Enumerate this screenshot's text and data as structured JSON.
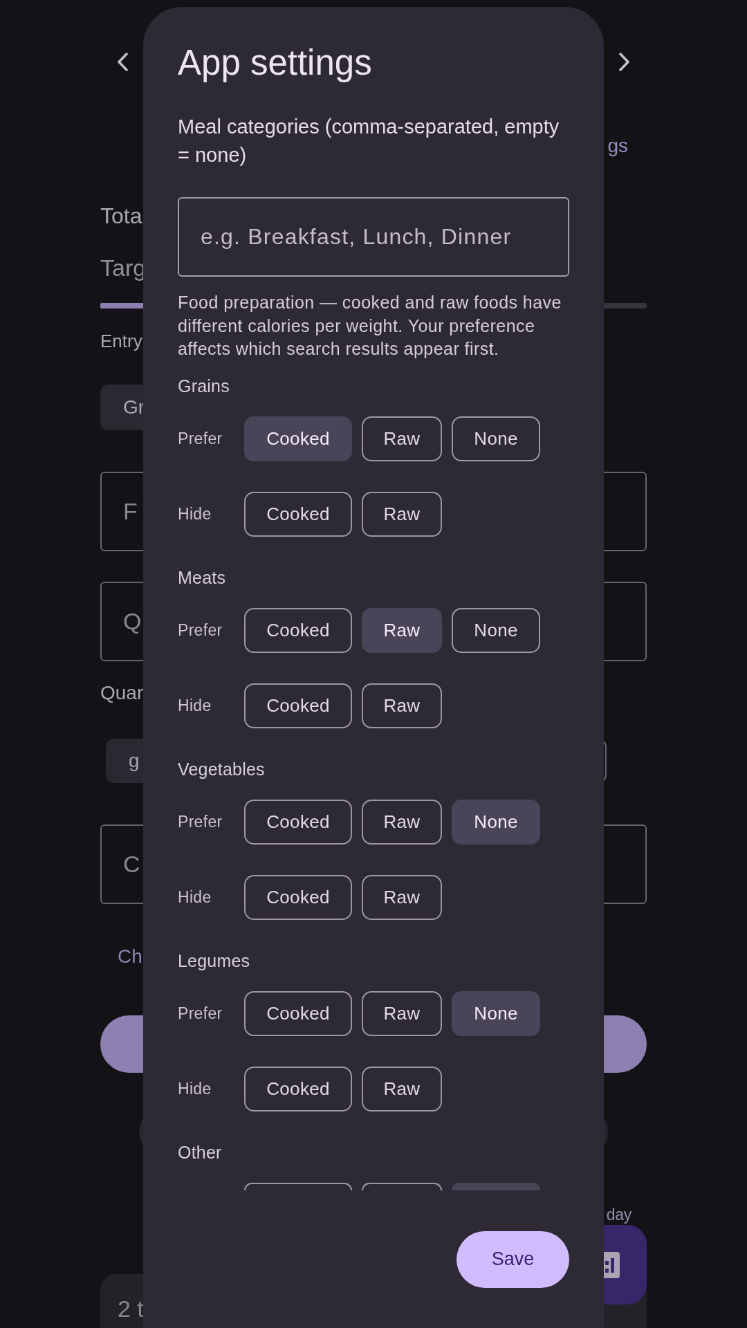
{
  "background": {
    "settings_link": "gs",
    "total_label": "Tota",
    "target_label": "Targ",
    "target_progress": {
      "level": 0.45
    },
    "entry_label": "Entry",
    "group_chip": "Gr",
    "food_field": {
      "placeholder": "F"
    },
    "quantity_field": {
      "placeholder": "Q"
    },
    "quantity_label": "Quar",
    "unit_chips": [
      {
        "label": "g",
        "selected": true
      },
      {
        "selected": false
      }
    ],
    "calories_field": {
      "placeholder": "C"
    },
    "link": "Ch",
    "today_label": "day",
    "entry_card": "2 t"
  },
  "dialog": {
    "title": "App settings",
    "categories_label": "Meal categories (comma-separated, empty = none)",
    "categories_field": {
      "placeholder": "e.g. Breakfast, Lunch, Dinner"
    },
    "note": "Food preparation — cooked and raw foods have different calories per weight. Your preference affects which search results appear first.",
    "sections": [
      {
        "name": "Grains",
        "rows": [
          {
            "label": "Prefer",
            "options": [
              {
                "label": "Cooked",
                "selected": true
              },
              {
                "label": "Raw",
                "selected": false
              },
              {
                "label": "None",
                "selected": false
              }
            ]
          },
          {
            "label": "Hide",
            "options": [
              {
                "label": "Cooked",
                "selected": false
              },
              {
                "label": "Raw",
                "selected": false
              }
            ]
          }
        ]
      },
      {
        "name": "Meats",
        "rows": [
          {
            "label": "Prefer",
            "options": [
              {
                "label": "Cooked",
                "selected": false
              },
              {
                "label": "Raw",
                "selected": true
              },
              {
                "label": "None",
                "selected": false
              }
            ]
          },
          {
            "label": "Hide",
            "options": [
              {
                "label": "Cooked",
                "selected": false
              },
              {
                "label": "Raw",
                "selected": false
              }
            ]
          }
        ]
      },
      {
        "name": "Vegetables",
        "rows": [
          {
            "label": "Prefer",
            "options": [
              {
                "label": "Cooked",
                "selected": false
              },
              {
                "label": "Raw",
                "selected": false
              },
              {
                "label": "None",
                "selected": true
              }
            ]
          },
          {
            "label": "Hide",
            "options": [
              {
                "label": "Cooked",
                "selected": false
              },
              {
                "label": "Raw",
                "selected": false
              }
            ]
          }
        ]
      },
      {
        "name": "Legumes",
        "rows": [
          {
            "label": "Prefer",
            "options": [
              {
                "label": "Cooked",
                "selected": false
              },
              {
                "label": "Raw",
                "selected": false
              },
              {
                "label": "None",
                "selected": true
              }
            ]
          },
          {
            "label": "Hide",
            "options": [
              {
                "label": "Cooked",
                "selected": false
              },
              {
                "label": "Raw",
                "selected": false
              }
            ]
          }
        ]
      },
      {
        "name": "Other",
        "rows": [
          {
            "options": [
              {
                "selected": false
              },
              {
                "selected": false
              },
              {
                "selected": true
              }
            ]
          }
        ]
      }
    ],
    "save_button": "Save"
  }
}
